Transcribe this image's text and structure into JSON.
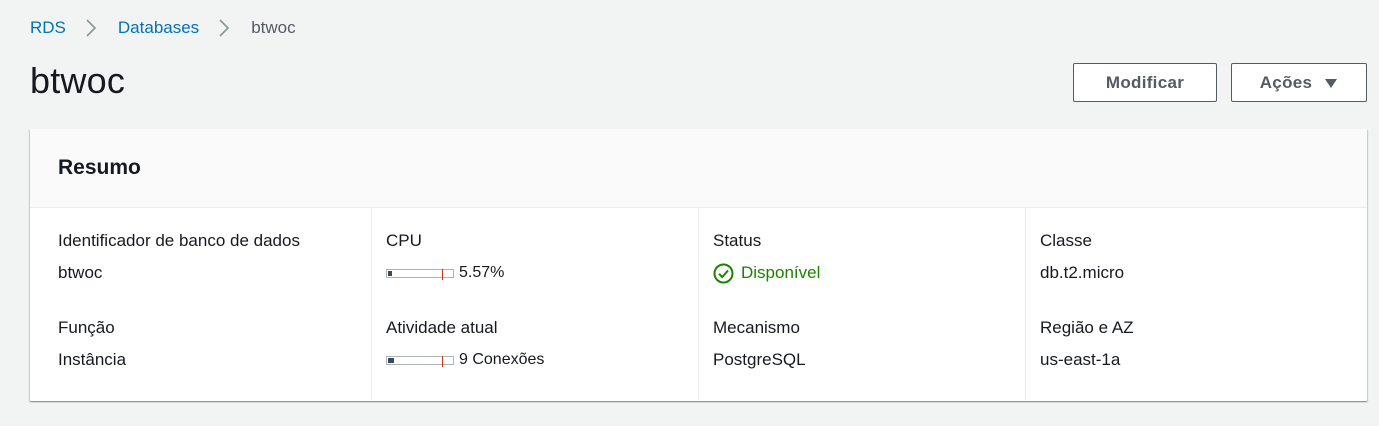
{
  "breadcrumb": {
    "items": [
      "RDS",
      "Databases"
    ],
    "current": "btwoc"
  },
  "page": {
    "title": "btwoc"
  },
  "actions": {
    "modify_label": "Modificar",
    "actions_label": "Ações"
  },
  "summary": {
    "title": "Resumo",
    "db_identifier": {
      "label": "Identificador de banco de dados",
      "value": "btwoc"
    },
    "role": {
      "label": "Função",
      "value": "Instância"
    },
    "cpu": {
      "label": "CPU",
      "value": "5.57%",
      "fraction": 0.0557
    },
    "activity": {
      "label": "Atividade atual",
      "value": "9 Conexões",
      "fraction": 0.09
    },
    "status": {
      "label": "Status",
      "value": "Disponível"
    },
    "engine": {
      "label": "Mecanismo",
      "value": "PostgreSQL"
    },
    "class": {
      "label": "Classe",
      "value": "db.t2.micro"
    },
    "region": {
      "label": "Região e AZ",
      "value": "us-east-1a"
    }
  },
  "colors": {
    "link": "#0073bb",
    "success": "#1d8102",
    "threshold": "#d13212"
  },
  "icons": {
    "separator": "chevron-right-icon",
    "actions_caret": "caret-down-icon",
    "status": "check-circle-icon"
  }
}
